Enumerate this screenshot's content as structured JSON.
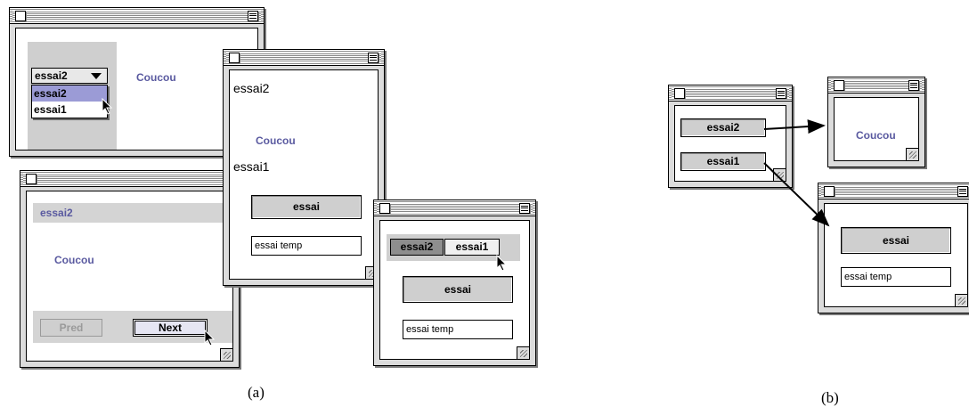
{
  "panel_a": {
    "caption": "(a)",
    "win1": {
      "popup_value": "essai2",
      "menu_items": [
        "essai2",
        "essai1"
      ],
      "label": "Coucou"
    },
    "win2": {
      "header": "essai2",
      "label": "Coucou",
      "prev_label": "Pred",
      "next_label": "Next"
    },
    "win3": {
      "top_label": "essai2",
      "purple_label": "Coucou",
      "mid_label": "essai1",
      "button_label": "essai",
      "field_value": "essai temp"
    },
    "win4": {
      "tabs": [
        "essai2",
        "essai1"
      ],
      "button_label": "essai",
      "field_value": "essai temp"
    }
  },
  "panel_b": {
    "caption": "(b)",
    "main_window": {
      "buttons": [
        "essai2",
        "essai1"
      ]
    },
    "target1": {
      "label": "Coucou"
    },
    "target2": {
      "button_label": "essai",
      "field_value": "essai temp"
    }
  },
  "colors": {
    "accent_purple": "#5a5aa0",
    "selection": "#9b9bd6",
    "window_gray": "#dcdcdc"
  },
  "icons": [
    "close-box-icon",
    "zoom-box-icon",
    "grow-box-icon",
    "cursor-arrow-icon"
  ]
}
